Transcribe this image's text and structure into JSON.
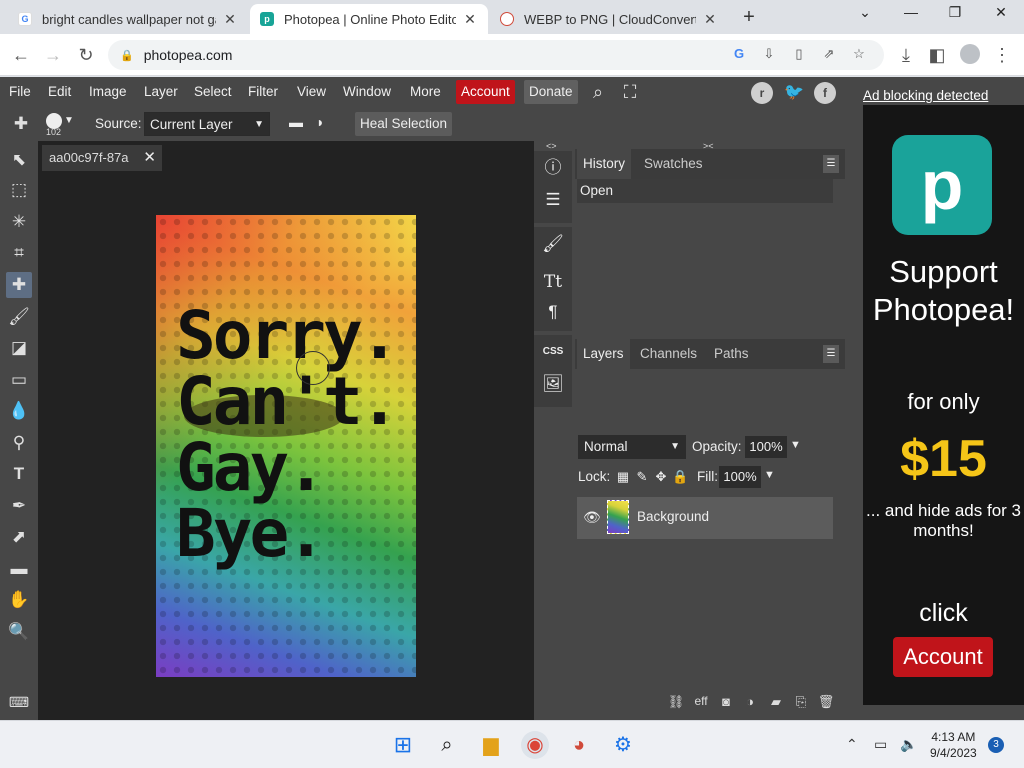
{
  "browser": {
    "tabs": [
      {
        "label": "bright candles wallpaper not gay",
        "favicon_color": "#4285f4"
      },
      {
        "label": "Photopea | Online Photo Editor",
        "favicon_color": "#18a497"
      },
      {
        "label": "WEBP to PNG | CloudConvert",
        "favicon_color": "#d04a3a"
      }
    ],
    "url": "photopea.com"
  },
  "menubar": {
    "items": [
      "File",
      "Edit",
      "Image",
      "Layer",
      "Select",
      "Filter",
      "View",
      "Window",
      "More"
    ],
    "account_label": "Account",
    "donate_label": "Donate"
  },
  "options": {
    "brush_size": "102",
    "source_label": "Source:",
    "source_value": "Current Layer",
    "heal_label": "Heal Selection"
  },
  "document": {
    "tab_title": "aa00c97f-87a",
    "canvas_text": [
      "Sorry.",
      "Can't.",
      "Gay.",
      "Bye."
    ]
  },
  "history": {
    "tabs": [
      "History",
      "Swatches"
    ],
    "items": [
      "Open"
    ]
  },
  "layers": {
    "tabs": [
      "Layers",
      "Channels",
      "Paths"
    ],
    "blend_mode": "Normal",
    "opacity_label": "Opacity:",
    "opacity": "100%",
    "lock_label": "Lock:",
    "fill_label": "Fill:",
    "fill": "100%",
    "items": [
      {
        "name": "Background"
      }
    ]
  },
  "ad": {
    "blocking_text": "Ad blocking detected",
    "headline": "Support Photopea!",
    "for_only": "for only",
    "price": "$15",
    "subtext": "... and hide ads for 3 months!",
    "click": "click",
    "button": "Account"
  },
  "taskbar": {
    "time": "4:13 AM",
    "date": "9/4/2023",
    "notifications": "3"
  },
  "colors": {
    "accent_red": "#c0141a",
    "photopea_teal": "#1aa39a",
    "price_yellow": "#f5c518"
  }
}
